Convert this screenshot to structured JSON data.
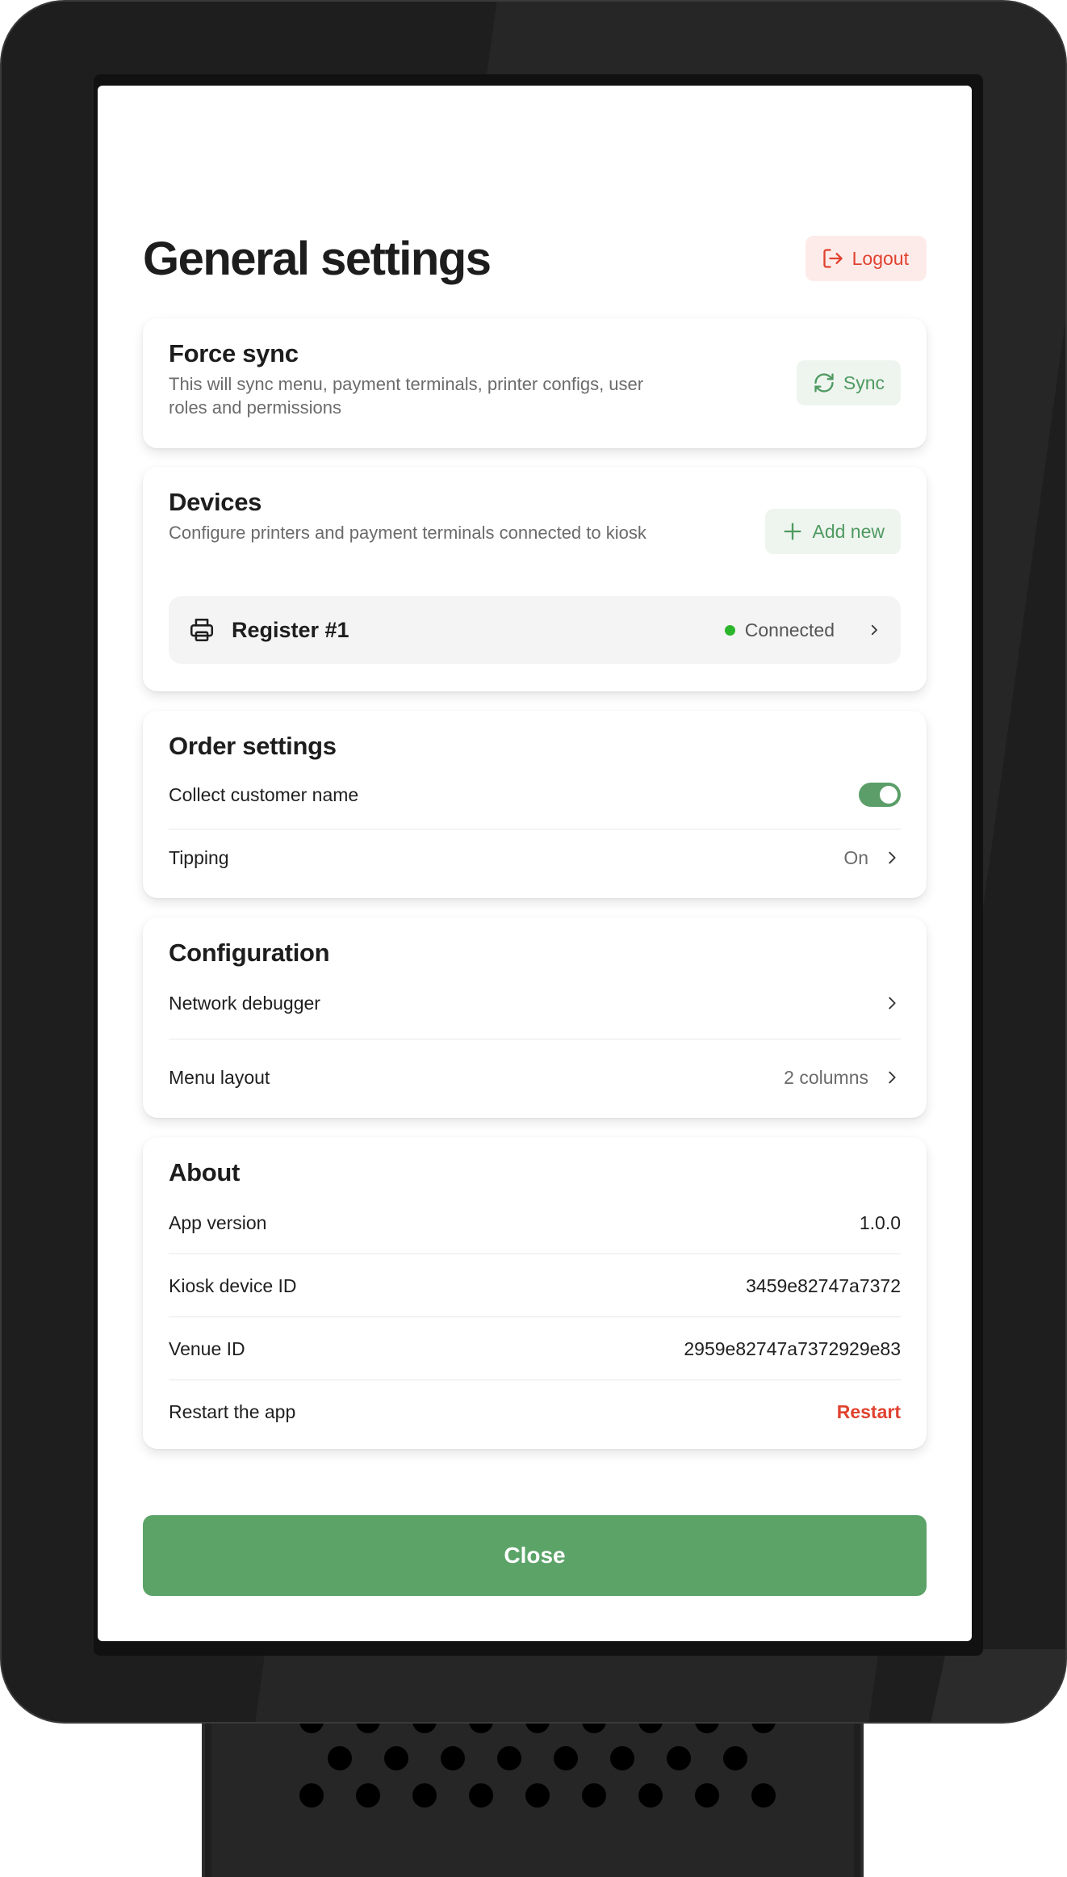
{
  "header": {
    "title": "General settings",
    "logout_label": "Logout"
  },
  "force_sync": {
    "title": "Force sync",
    "description": "This will sync menu, payment terminals, printer configs, user roles and permissions",
    "button_label": "Sync"
  },
  "devices": {
    "title": "Devices",
    "description": "Configure printers and payment terminals connected to kiosk",
    "add_label": "Add new",
    "items": [
      {
        "name": "Register #1",
        "status": "Connected"
      }
    ]
  },
  "order_settings": {
    "title": "Order settings",
    "rows": [
      {
        "label": "Collect customer name",
        "toggle_on": true
      },
      {
        "label": "Tipping",
        "value": "On"
      }
    ]
  },
  "configuration": {
    "title": "Configuration",
    "rows": [
      {
        "label": "Network debugger",
        "value": ""
      },
      {
        "label": "Menu layout",
        "value": "2 columns"
      }
    ]
  },
  "about": {
    "title": "About",
    "rows": [
      {
        "label": "App version",
        "value": "1.0.0"
      },
      {
        "label": "Kiosk device ID",
        "value": "3459e82747a7372"
      },
      {
        "label": "Venue ID",
        "value": "2959e82747a7372929e83"
      },
      {
        "label": "Restart the app",
        "action": "Restart"
      }
    ]
  },
  "footer": {
    "close_label": "Close"
  },
  "colors": {
    "accent_green": "#5ca368",
    "danger_red": "#e0422f",
    "status_connected": "#2bb52b"
  }
}
